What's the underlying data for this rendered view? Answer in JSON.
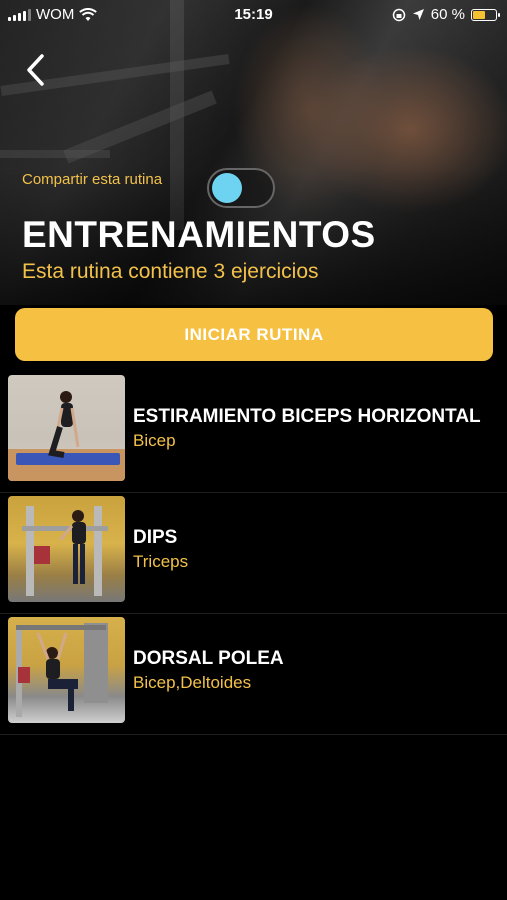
{
  "status_bar": {
    "carrier": "WOM",
    "time": "15:19",
    "battery_percent": "60 %",
    "battery_level": 0.6,
    "wifi_icon": "wifi-icon",
    "location_icon": "location-arrow-icon",
    "lock_icon": "orientation-lock-icon"
  },
  "header": {
    "back_icon": "chevron-left-icon",
    "share_label": "Compartir esta rutina",
    "share_enabled": true,
    "title": "ENTRENAMIENTOS",
    "subtitle": "Esta rutina contiene 3 ejercicios"
  },
  "start_button": {
    "label": "INICIAR RUTINA"
  },
  "exercises": [
    {
      "name": "ESTIRAMIENTO BICEPS HORIZONTAL",
      "muscle": "Bicep"
    },
    {
      "name": "DIPS",
      "muscle": "Triceps"
    },
    {
      "name": "DORSAL POLEA",
      "muscle": "Bicep,Deltoides"
    }
  ],
  "colors": {
    "accent": "#f6c142",
    "accent_text": "#f2c14a",
    "toggle_knob": "#6ed3f0",
    "background": "#000000"
  }
}
